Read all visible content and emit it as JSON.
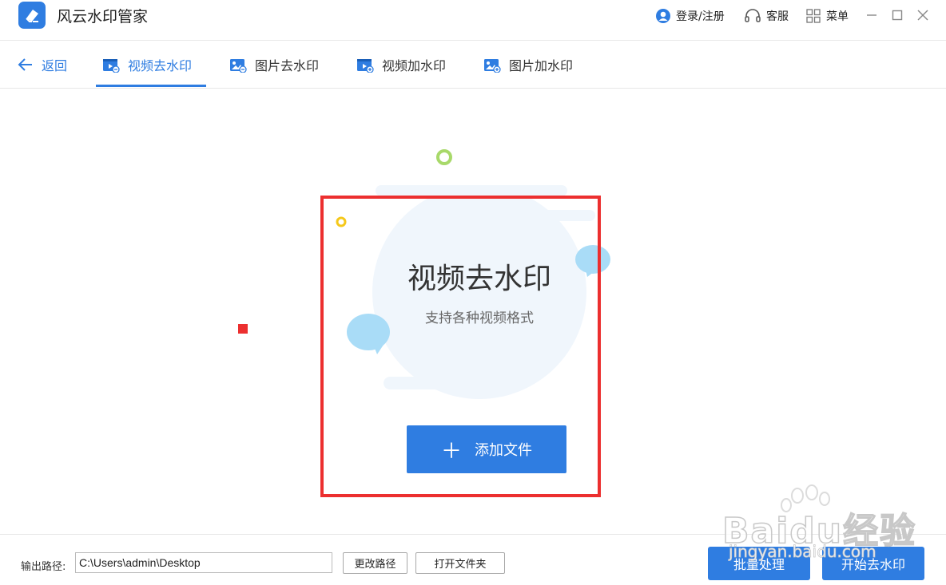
{
  "app": {
    "title": "风云水印管家"
  },
  "titlebar": {
    "login": "登录/注册",
    "service": "客服",
    "menu": "菜单"
  },
  "nav": {
    "back": "返回",
    "tabs": [
      {
        "label": "视频去水印",
        "active": true
      },
      {
        "label": "图片去水印",
        "active": false
      },
      {
        "label": "视频加水印",
        "active": false
      },
      {
        "label": "图片加水印",
        "active": false
      }
    ]
  },
  "hero": {
    "title": "视频去水印",
    "subtitle": "支持各种视频格式",
    "add_button": "添加文件"
  },
  "footer": {
    "output_label": "输出路径:",
    "output_path": "C:\\Users\\admin\\Desktop",
    "change_path": "更改路径",
    "open_folder": "打开文件夹",
    "batch": "批量处理",
    "start": "开始去水印"
  },
  "watermark": {
    "brand": "Baidu经验",
    "url": "jingyan.baidu.com"
  },
  "colors": {
    "accent": "#2f7de1",
    "highlight": "#ec2f2f"
  }
}
